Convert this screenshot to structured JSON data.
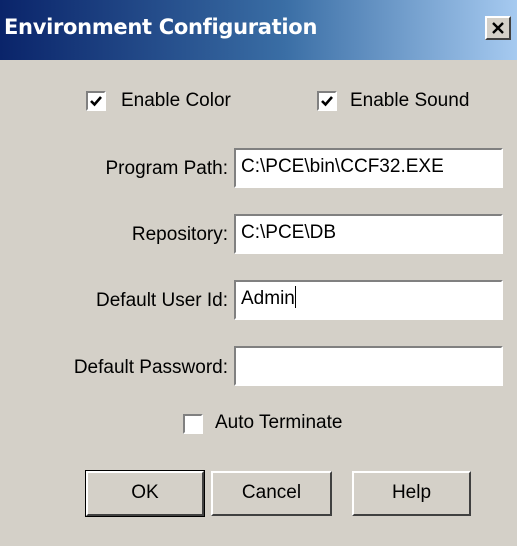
{
  "window": {
    "title": "Environment Configuration"
  },
  "options": {
    "enable_color": {
      "label": "Enable Color",
      "checked": true
    },
    "enable_sound": {
      "label": "Enable Sound",
      "checked": true
    },
    "auto_terminate": {
      "label": "Auto Terminate",
      "checked": false
    }
  },
  "fields": {
    "program_path": {
      "label": "Program Path:",
      "value": "C:\\PCE\\bin\\CCF32.EXE"
    },
    "repository": {
      "label": "Repository:",
      "value": "C:\\PCE\\DB"
    },
    "default_user_id": {
      "label": "Default User Id:",
      "value": "Admin"
    },
    "default_password": {
      "label": "Default Password:",
      "value": ""
    }
  },
  "buttons": {
    "ok": "OK",
    "cancel": "Cancel",
    "help": "Help"
  }
}
